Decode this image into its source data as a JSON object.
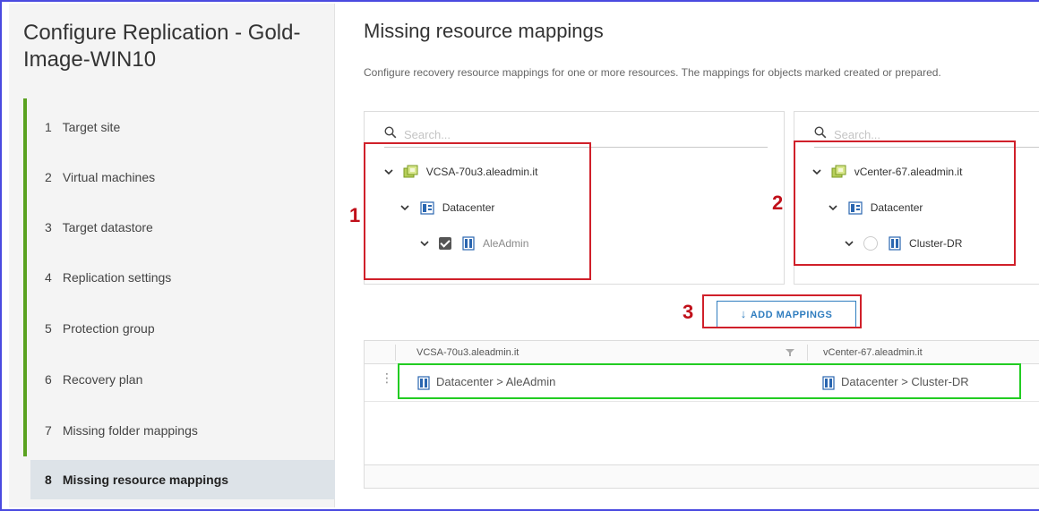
{
  "sidebar": {
    "title": "Configure Replication - Gold-Image-WIN10",
    "steps": [
      {
        "num": "1",
        "label": "Target site"
      },
      {
        "num": "2",
        "label": "Virtual machines"
      },
      {
        "num": "3",
        "label": "Target datastore"
      },
      {
        "num": "4",
        "label": "Replication settings"
      },
      {
        "num": "5",
        "label": "Protection group"
      },
      {
        "num": "6",
        "label": "Recovery plan"
      },
      {
        "num": "7",
        "label": "Missing folder mappings"
      },
      {
        "num": "8",
        "label": "Missing resource mappings"
      }
    ],
    "active_step": 8
  },
  "main": {
    "title": "Missing resource mappings",
    "description": "Configure recovery resource mappings for one or more resources. The mappings for objects marked created or prepared."
  },
  "left_tree": {
    "search_placeholder": "Search...",
    "vcenter": "VCSA-70u3.aleadmin.it",
    "datacenter": "Datacenter",
    "resource": "AleAdmin",
    "resource_checked": true
  },
  "right_tree": {
    "search_placeholder": "Search...",
    "vcenter": "vCenter-67.aleadmin.it",
    "datacenter": "Datacenter",
    "resource": "Cluster-DR",
    "resource_selected": false
  },
  "annotations": {
    "marker1": "1",
    "marker2": "2",
    "marker3": "3"
  },
  "add_button": {
    "arrow": "↓",
    "label": "ADD MAPPINGS"
  },
  "grid": {
    "columns": [
      "VCSA-70u3.aleadmin.it",
      "vCenter-67.aleadmin.it"
    ],
    "rows": [
      {
        "source": "Datacenter > AleAdmin",
        "target": "Datacenter > Cluster-DR"
      }
    ],
    "row_menu": "⋮"
  },
  "colors": {
    "accent_green": "#5aa220",
    "annotation_red": "#d0202a",
    "annotation_green": "#22cc22",
    "link_blue": "#2f7dbf",
    "active_step_bg": "#dde3e8"
  },
  "icons": {
    "vcenter": "vcenter-icon",
    "datacenter": "datacenter-icon",
    "cluster": "cluster-icon",
    "search": "search-icon",
    "chevron": "chevron-down-icon",
    "filter": "filter-icon"
  }
}
